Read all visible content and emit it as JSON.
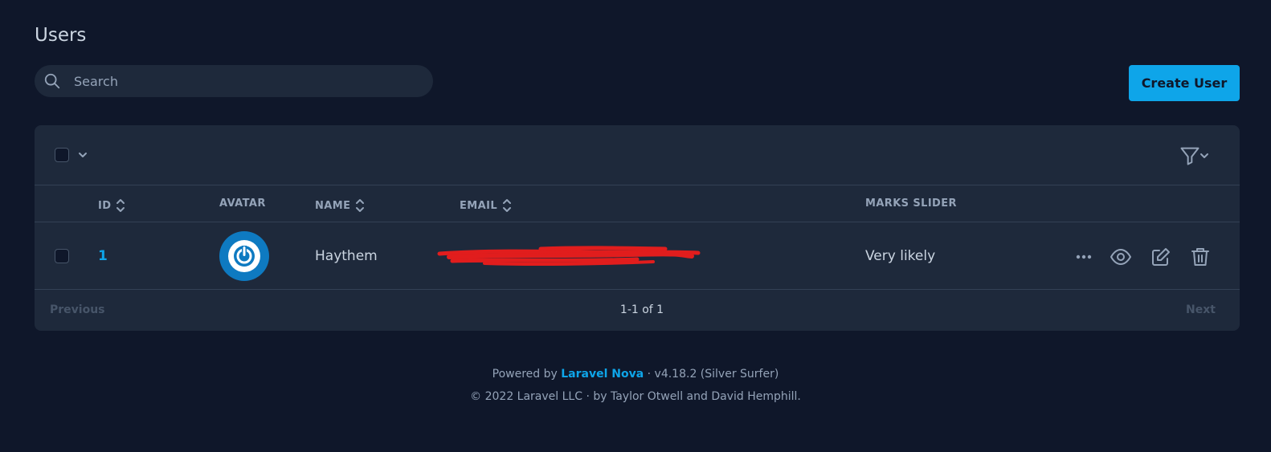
{
  "page": {
    "title": "Users"
  },
  "search": {
    "placeholder": "Search",
    "value": ""
  },
  "actions": {
    "create_label": "Create User"
  },
  "table": {
    "columns": [
      {
        "key": "id",
        "label": "ID",
        "sortable": true
      },
      {
        "key": "avatar",
        "label": "AVATAR",
        "sortable": false
      },
      {
        "key": "name",
        "label": "NAME",
        "sortable": true
      },
      {
        "key": "email",
        "label": "EMAIL",
        "sortable": true
      },
      {
        "key": "marks_slider",
        "label": "MARKS SLIDER",
        "sortable": false
      }
    ],
    "rows": [
      {
        "id": "1",
        "avatar": "power-icon",
        "name": "Haythem",
        "email": "",
        "marks_slider": "Very likely"
      }
    ]
  },
  "pagination": {
    "previous": "Previous",
    "next": "Next",
    "status": "1-1 of 1"
  },
  "footer": {
    "powered_prefix": "Powered by",
    "brand": "Laravel Nova",
    "version": "· v4.18.2 (Silver Surfer)",
    "copyright": "© 2022 Laravel LLC · by Taylor Otwell and David Hemphill."
  },
  "colors": {
    "background": "#0f172a",
    "card": "#1e293b",
    "accent": "#0ea5e9",
    "redaction": "#e11d1d"
  }
}
